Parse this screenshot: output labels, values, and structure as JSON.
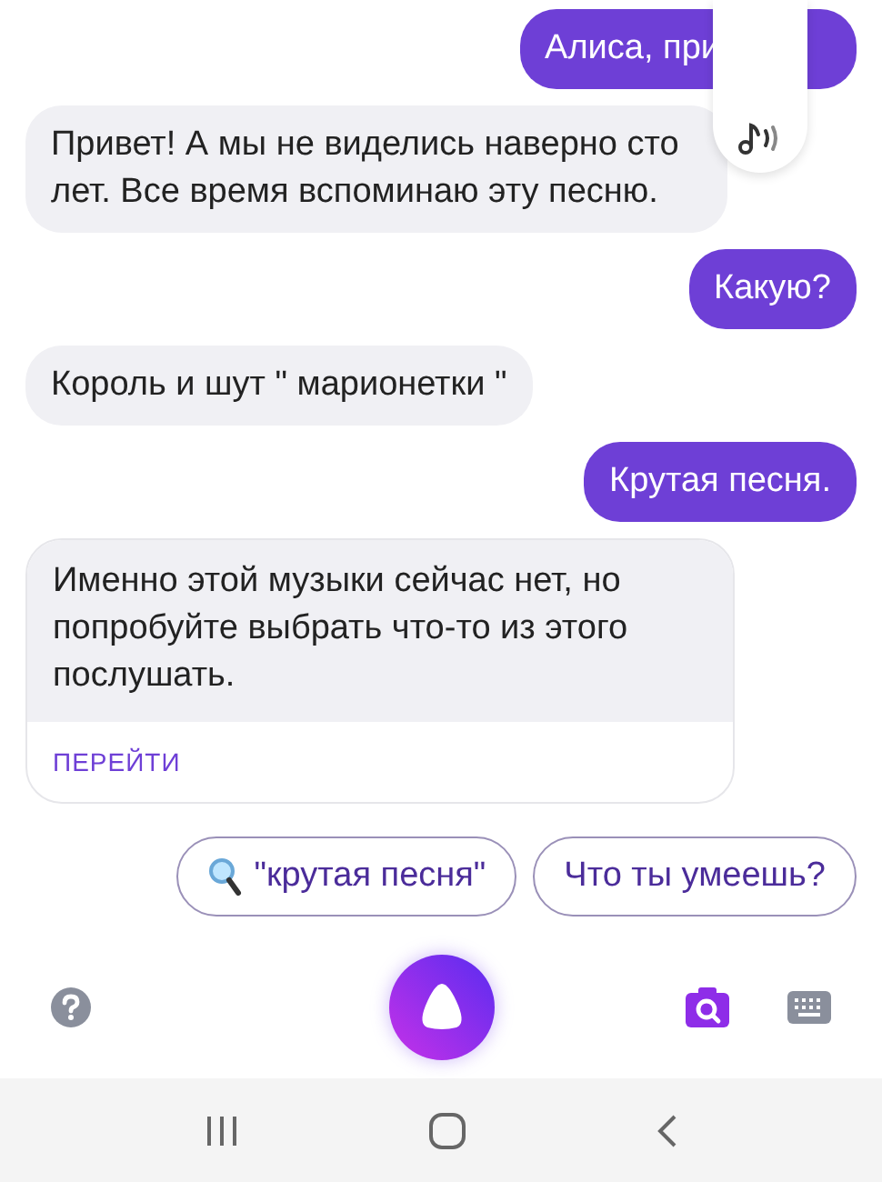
{
  "messages": [
    {
      "kind": "outgoing",
      "text": "Алиса, при"
    },
    {
      "kind": "incoming",
      "text": "Привет! А мы не виделись наверно сто лет. Все время вспоминаю эту песню."
    },
    {
      "kind": "outgoing",
      "text": "Какую?"
    },
    {
      "kind": "incoming",
      "text": "Король и шут \" марионетки \""
    },
    {
      "kind": "outgoing",
      "text": "Крутая песня."
    },
    {
      "kind": "card",
      "text": "Именно этой музыки сейчас нет, но попробуйте выбрать что-то из этого послушать.",
      "link": "ПЕРЕЙТИ"
    }
  ],
  "suggestions": [
    {
      "kind": "search",
      "text": "\"крутая песня\""
    },
    {
      "kind": "plain",
      "text": "Что ты умеешь?"
    }
  ]
}
